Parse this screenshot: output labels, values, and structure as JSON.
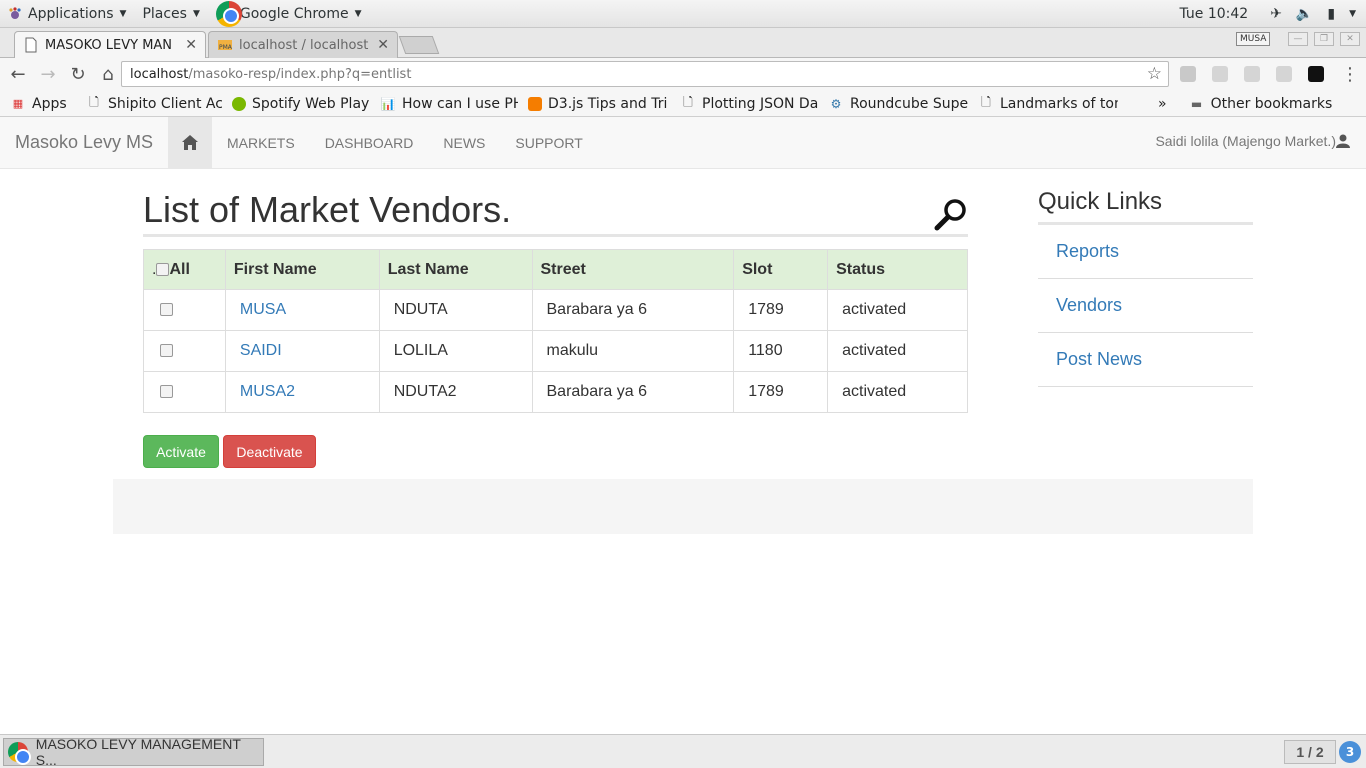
{
  "gnome": {
    "applications": "Applications",
    "places": "Places",
    "browser_name": "Google Chrome",
    "clock": "Tue 10:42"
  },
  "tabs": [
    {
      "title": "MASOKO LEVY MAN",
      "active": true
    },
    {
      "title": "localhost / localhost",
      "active": false
    }
  ],
  "profile_badge": "MUSA",
  "address": {
    "host": "localhost",
    "path": "/masoko-resp/index.php?q=entlist"
  },
  "bookmarks": [
    {
      "label": "Apps",
      "icon": "apps-grid-icon"
    },
    {
      "label": "Shipito Client Acc",
      "icon": "page-icon"
    },
    {
      "label": "Spotify Web Play",
      "icon": "spotify-icon"
    },
    {
      "label": "How can I use PH",
      "icon": "chart-icon"
    },
    {
      "label": "D3.js Tips and Tri",
      "icon": "blogger-icon"
    },
    {
      "label": "Plotting JSON Da",
      "icon": "page-icon"
    },
    {
      "label": "Roundcube Super",
      "icon": "roundcube-icon"
    },
    {
      "label": "Landmarks of ton",
      "icon": "page-icon"
    }
  ],
  "bookmarks_more": "»",
  "other_bookmarks": "Other bookmarks",
  "navbar": {
    "brand": "Masoko Levy MS",
    "links": [
      "MARKETS",
      "DASHBOARD",
      "NEWS",
      "SUPPORT"
    ],
    "user": "Saidi lolila (Majengo Market.)"
  },
  "main": {
    "title": "List of Market Vendors.",
    "table": {
      "headers": [
        ".All",
        "First Name",
        "Last Name",
        "Street",
        "Slot",
        "Status"
      ],
      "rows": [
        {
          "first": "MUSA",
          "last": "NDUTA",
          "street": "Barabara ya 6",
          "slot": "1789",
          "status": "activated"
        },
        {
          "first": "SAIDI",
          "last": "LOLILA",
          "street": "makulu",
          "slot": "1180",
          "status": "activated"
        },
        {
          "first": "MUSA2",
          "last": "NDUTA2",
          "street": "Barabara ya 6",
          "slot": "1789",
          "status": "activated"
        }
      ]
    },
    "activate_label": "Activate",
    "deactivate_label": "Deactivate"
  },
  "sidebar": {
    "title": "Quick Links",
    "links": [
      "Reports",
      "Vendors",
      "Post News"
    ]
  },
  "taskbar": {
    "window_title": "MASOKO LEVY MANAGEMENT S...",
    "workspace": "1 / 2",
    "notifications": "3"
  },
  "colors": {
    "accent_link": "#337ab7",
    "header_bg": "#dff0d8",
    "activate": "#5cb85c",
    "deactivate": "#d9534f"
  }
}
